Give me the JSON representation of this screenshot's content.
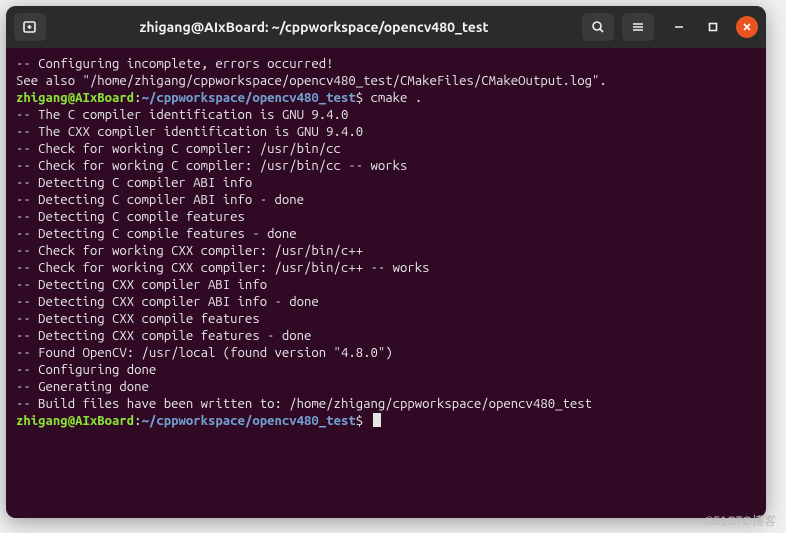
{
  "window": {
    "title": "zhigang@AIxBoard: ~/cppworkspace/opencv480_test"
  },
  "prompt": {
    "user_host": "zhigang@AIxBoard",
    "sep1": ":",
    "path": "~/cppworkspace/opencv480_test",
    "sep2": "$ ",
    "command": "cmake ."
  },
  "icons": {
    "newtab": "new-tab-icon",
    "search": "search-icon",
    "menu": "hamburger-icon",
    "minimize": "minimize-icon",
    "maximize": "maximize-icon",
    "close": "close-icon"
  },
  "lines": [
    {
      "segs": [
        {
          "t": "",
          "c": "c-default"
        }
      ]
    },
    {
      "segs": [
        {
          "t": "",
          "c": "c-default"
        }
      ]
    },
    {
      "segs": [
        {
          "t": "-- Configuring incomplete, errors occurred!",
          "c": "c-default"
        }
      ]
    },
    {
      "segs": [
        {
          "t": "See also \"/home/zhigang/cppworkspace/opencv480_test/CMakeFiles/CMakeOutput.log\".",
          "c": "c-default"
        }
      ]
    },
    {
      "segs": [
        {
          "t": "zhigang@AIxBoard",
          "c": "c-green"
        },
        {
          "t": ":",
          "c": "c-default"
        },
        {
          "t": "~/cppworkspace/opencv480_test",
          "c": "c-blue"
        },
        {
          "t": "$ ",
          "c": "c-default"
        },
        {
          "t": "cmake .",
          "c": "c-default"
        }
      ]
    },
    {
      "segs": [
        {
          "t": "-- The C compiler identification is GNU 9.4.0",
          "c": "c-default"
        }
      ]
    },
    {
      "segs": [
        {
          "t": "-- The CXX compiler identification is GNU 9.4.0",
          "c": "c-default"
        }
      ]
    },
    {
      "segs": [
        {
          "t": "-- Check for working C compiler: /usr/bin/cc",
          "c": "c-default"
        }
      ]
    },
    {
      "segs": [
        {
          "t": "-- Check for working C compiler: /usr/bin/cc -- works",
          "c": "c-default"
        }
      ]
    },
    {
      "segs": [
        {
          "t": "-- Detecting C compiler ABI info",
          "c": "c-default"
        }
      ]
    },
    {
      "segs": [
        {
          "t": "-- Detecting C compiler ABI info - done",
          "c": "c-default"
        }
      ]
    },
    {
      "segs": [
        {
          "t": "-- Detecting C compile features",
          "c": "c-default"
        }
      ]
    },
    {
      "segs": [
        {
          "t": "-- Detecting C compile features - done",
          "c": "c-default"
        }
      ]
    },
    {
      "segs": [
        {
          "t": "-- Check for working CXX compiler: /usr/bin/c++",
          "c": "c-default"
        }
      ]
    },
    {
      "segs": [
        {
          "t": "-- Check for working CXX compiler: /usr/bin/c++ -- works",
          "c": "c-default"
        }
      ]
    },
    {
      "segs": [
        {
          "t": "-- Detecting CXX compiler ABI info",
          "c": "c-default"
        }
      ]
    },
    {
      "segs": [
        {
          "t": "-- Detecting CXX compiler ABI info - done",
          "c": "c-default"
        }
      ]
    },
    {
      "segs": [
        {
          "t": "-- Detecting CXX compile features",
          "c": "c-default"
        }
      ]
    },
    {
      "segs": [
        {
          "t": "-- Detecting CXX compile features - done",
          "c": "c-default"
        }
      ]
    },
    {
      "segs": [
        {
          "t": "-- Found OpenCV: /usr/local (found version \"4.8.0\")",
          "c": "c-default"
        }
      ]
    },
    {
      "segs": [
        {
          "t": "-- Configuring done",
          "c": "c-default"
        }
      ]
    },
    {
      "segs": [
        {
          "t": "-- Generating done",
          "c": "c-default"
        }
      ]
    },
    {
      "segs": [
        {
          "t": "-- Build files have been written to: /home/zhigang/cppworkspace/opencv480_test",
          "c": "c-default"
        }
      ]
    },
    {
      "segs": [
        {
          "t": "zhigang@AIxBoard",
          "c": "c-green"
        },
        {
          "t": ":",
          "c": "c-default"
        },
        {
          "t": "~/cppworkspace/opencv480_test",
          "c": "c-blue"
        },
        {
          "t": "$ ",
          "c": "c-default"
        }
      ],
      "cursor": true
    }
  ],
  "watermark": "©51CTO博客"
}
